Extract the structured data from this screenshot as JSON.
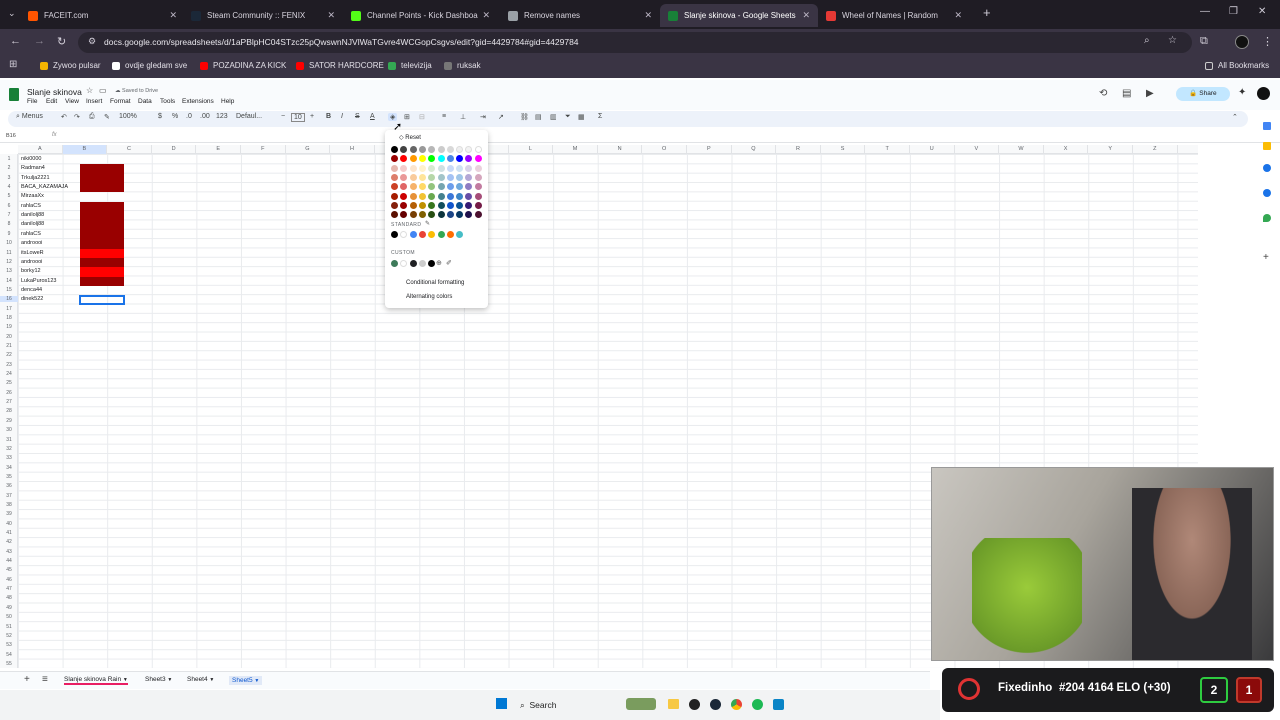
{
  "browser": {
    "tabs": [
      {
        "title": "FACEIT.com",
        "color": "#ff5500"
      },
      {
        "title": "Steam Community :: FENIX",
        "color": "#1b2838"
      },
      {
        "title": "Channel Points - Kick Dashboard",
        "color": "#53fc18"
      },
      {
        "title": "Remove names",
        "color": "#9aa0a6"
      },
      {
        "title": "Slanje skinova - Google Sheets",
        "color": "#188038"
      },
      {
        "title": "Wheel of Names | Random",
        "color": "#e53935"
      }
    ],
    "url": "docs.google.com/spreadsheets/d/1aPBlpHC04STzc25pQwswnNJVlWaTGvre4WCGopCsgvs/edit?gid=4429784#gid=4429784",
    "bookmarks": [
      {
        "label": "Zywoo pulsar",
        "color": "#f4b400"
      },
      {
        "label": "ovdje gledam sve",
        "color": "#ffffff"
      },
      {
        "label": "POZADINA ZA KICK",
        "color": "#ff0000"
      },
      {
        "label": "SATOR HARDCORE",
        "color": "#ff0000"
      },
      {
        "label": "televizija",
        "color": "#34a853"
      },
      {
        "label": "ruksak",
        "color": "#777777"
      }
    ],
    "all_bookmarks": "All Bookmarks"
  },
  "sheets": {
    "title": "Slanje skinova",
    "saved": "Saved to Drive",
    "menu": [
      "File",
      "Edit",
      "View",
      "Insert",
      "Format",
      "Data",
      "Tools",
      "Extensions",
      "Help"
    ],
    "toolbar": {
      "search": "Menus",
      "zoom": "100%",
      "currency": "$",
      "percent": "%",
      "dec1": ".0",
      "dec2": ".00",
      "numfmt": "123",
      "font": "Defaul...",
      "size": "10"
    },
    "share": "Share",
    "cellref": "B16",
    "columns": [
      "A",
      "B",
      "C",
      "D",
      "E",
      "F",
      "G",
      "H",
      "I",
      "J",
      "K",
      "L",
      "M",
      "N",
      "O",
      "P",
      "Q",
      "R",
      "S",
      "T",
      "U",
      "V",
      "W",
      "X",
      "Y",
      "Z"
    ],
    "names": [
      "niki0000",
      "Radman4",
      "Trkulja2221",
      "BACA_KAZAMAJA",
      "MirzaaXx",
      "rahlaCS",
      "danilolj88",
      "danilolj88",
      "rahlaCS",
      "androooi",
      "itsLoweR",
      "androooi",
      "borky12",
      "LukaPuros123",
      "denca44",
      "dinek522"
    ],
    "fills": [
      "#ffffff",
      "#990000",
      "#990000",
      "#990000",
      "#ffffff",
      "#990000",
      "#990000",
      "#990000",
      "#990000",
      "#990000",
      "#ff0000",
      "#990000",
      "#ff0000",
      "#990000",
      "#ffffff",
      "#ffffff"
    ],
    "sheet_tabs": [
      "Slanje skinova Rain",
      "Sheet3",
      "Sheet4",
      "Sheet5"
    ]
  },
  "palette": {
    "reset": "Reset",
    "standard": "STANDARD",
    "custom": "CUSTOM",
    "conditional": "Conditional formatting",
    "alternating": "Alternating colors",
    "grid": [
      [
        "#000000",
        "#434343",
        "#666666",
        "#999999",
        "#b7b7b7",
        "#cccccc",
        "#d9d9d9",
        "#efefef",
        "#f3f3f3",
        "#ffffff"
      ],
      [
        "#980000",
        "#ff0000",
        "#ff9900",
        "#ffff00",
        "#00ff00",
        "#00ffff",
        "#4a86e8",
        "#0000ff",
        "#9900ff",
        "#ff00ff"
      ],
      [
        "#e6b8af",
        "#f4cccc",
        "#fce5cd",
        "#fff2cc",
        "#d9ead3",
        "#d0e0e3",
        "#c9daf8",
        "#cfe2f3",
        "#d9d2e9",
        "#ead1dc"
      ],
      [
        "#dd7e6b",
        "#ea9999",
        "#f9cb9c",
        "#ffe599",
        "#b6d7a8",
        "#a2c4c9",
        "#a4c2f4",
        "#9fc5e8",
        "#b4a7d6",
        "#d5a6bd"
      ],
      [
        "#cc4125",
        "#e06666",
        "#f6b26b",
        "#ffd966",
        "#93c47d",
        "#76a5af",
        "#6d9eeb",
        "#6fa8dc",
        "#8e7cc3",
        "#c27ba0"
      ],
      [
        "#a61c00",
        "#cc0000",
        "#e69138",
        "#f1c232",
        "#6aa84f",
        "#45818e",
        "#3c78d8",
        "#3d85c6",
        "#674ea7",
        "#a64d79"
      ],
      [
        "#85200c",
        "#990000",
        "#b45f06",
        "#bf9000",
        "#38761d",
        "#134f5c",
        "#1155cc",
        "#0b5394",
        "#351c75",
        "#741b47"
      ],
      [
        "#5b0f00",
        "#660000",
        "#783f04",
        "#7f6000",
        "#274e13",
        "#0c343d",
        "#1c4587",
        "#073763",
        "#20124d",
        "#4c1130"
      ]
    ],
    "standard_colors": [
      "#000000",
      "#ffffff",
      "#4285f4",
      "#ea4335",
      "#fbbc04",
      "#34a853",
      "#ff6d01",
      "#46bdc6"
    ],
    "custom_colors": [
      "#3d7a5a",
      "#ffffff",
      "#202124",
      "#cccccc",
      "#000000"
    ]
  },
  "taskbar": {
    "search": "Search"
  },
  "overlay": {
    "name": "Fixedinho",
    "stats": "#204 4164 ELO (+30)",
    "wins": "2",
    "losses": "1"
  }
}
